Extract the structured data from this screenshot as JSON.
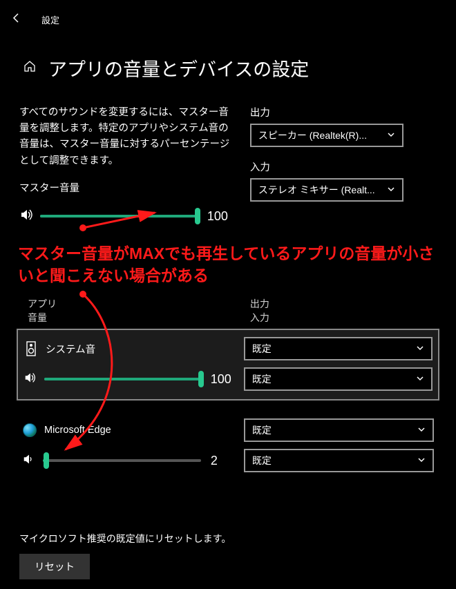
{
  "header": {
    "back_icon": "arrow-left",
    "title": "設定"
  },
  "page": {
    "home_icon": "home",
    "title": "アプリの音量とデバイスの設定"
  },
  "master": {
    "description": "すべてのサウンドを変更するには、マスター音量を調整します。特定のアプリやシステム音の音量は、マスター音量に対するパーセンテージとして調整できます。",
    "label": "マスター音量",
    "value": 100,
    "slider_percent": 100
  },
  "output": {
    "label": "出力",
    "selected": "スピーカー (Realtek(R)..."
  },
  "input": {
    "label": "入力",
    "selected": "ステレオ ミキサー (Realt..."
  },
  "annotation": "マスター音量がMAXでも再生しているアプリの音量が小さいと聞こえない場合がある",
  "mixer_header": {
    "left_line1": "アプリ",
    "left_line2": "音量",
    "right_line1": "出力",
    "right_line2": "入力"
  },
  "apps": [
    {
      "name": "システム音",
      "icon": "system-sound",
      "volume": 100,
      "slider_percent": 100,
      "output": "既定",
      "input": "既定",
      "highlight": true
    },
    {
      "name": "Microsoft Edge",
      "icon": "edge",
      "volume": 2,
      "slider_percent": 2,
      "output": "既定",
      "input": "既定",
      "highlight": false
    }
  ],
  "reset": {
    "description": "マイクロソフト推奨の既定値にリセットします。",
    "button": "リセット"
  },
  "colors": {
    "accent": "#28c98f",
    "annotation": "#ff1a1a"
  }
}
